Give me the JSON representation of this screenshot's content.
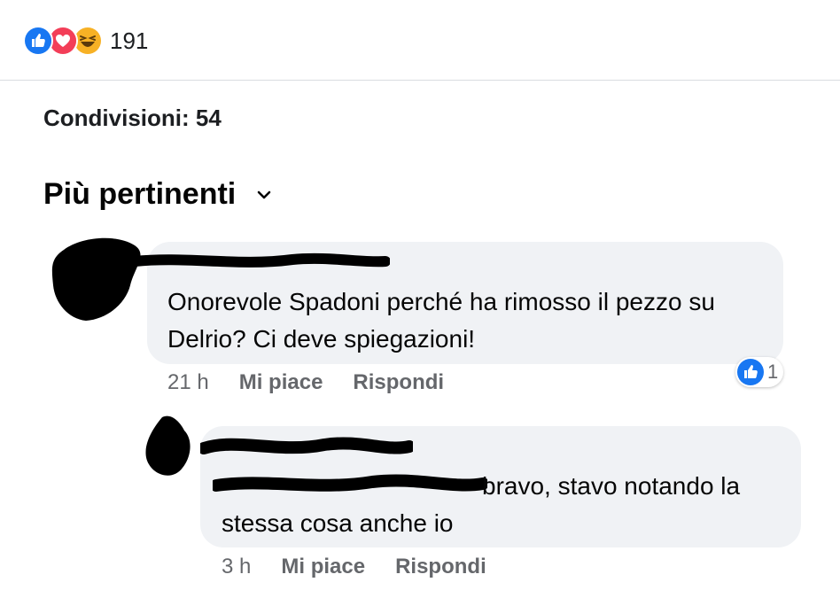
{
  "reactions": {
    "icons": [
      "like-icon",
      "love-icon",
      "haha-icon"
    ],
    "count": "191",
    "colors": {
      "like": "#1877f2",
      "love": "#f33e58",
      "haha": "#f7b125"
    }
  },
  "shares": {
    "label": "Condivisioni: 54"
  },
  "sort": {
    "label": "Più pertinenti",
    "icon": "chevron-down-icon"
  },
  "comments": [
    {
      "text": "Onorevole Spadoni perché ha rimosso il pezzo su Delrio? Ci deve spiegazioni!",
      "time": "21 h",
      "like_label": "Mi piace",
      "reply_label": "Rispondi",
      "like_count": "1"
    },
    {
      "text": "bravo, stavo notando la stessa cosa anche io",
      "time": "3 h",
      "like_label": "Mi piace",
      "reply_label": "Rispondi"
    }
  ]
}
